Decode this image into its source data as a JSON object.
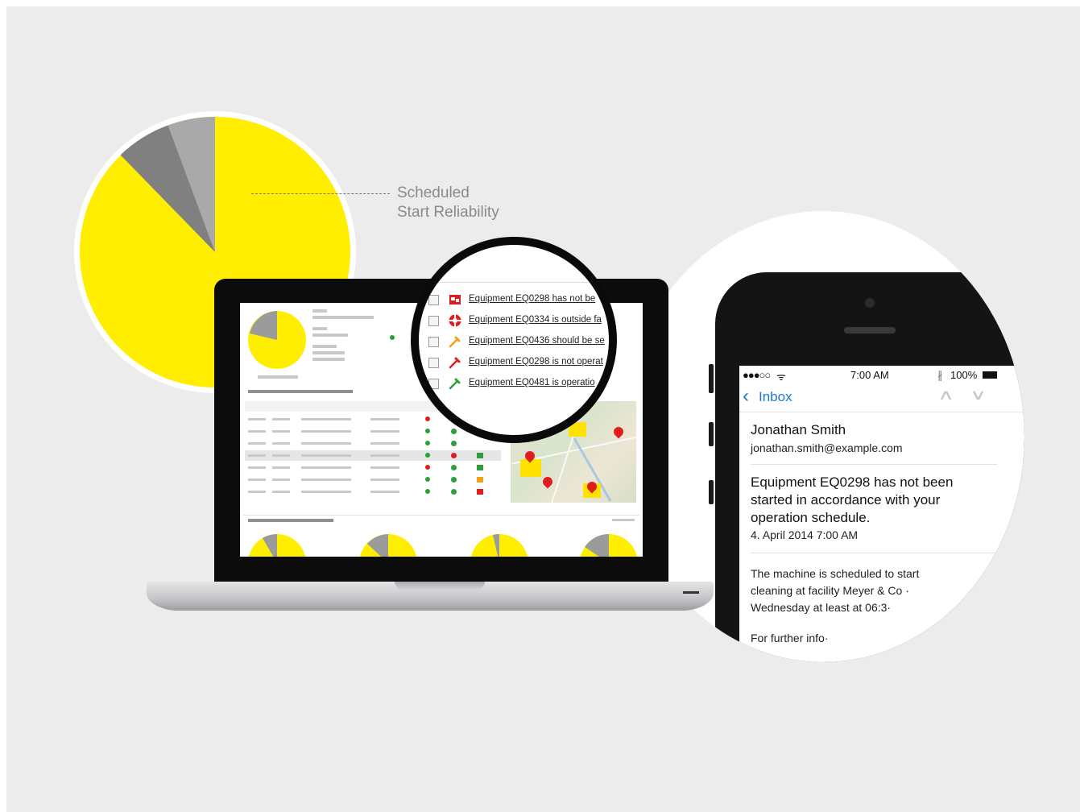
{
  "pie_label": {
    "line1": "Scheduled",
    "line2": "Start Reliability"
  },
  "colors": {
    "accent_yellow": "#ffee00",
    "slice_dark_gray": "#808080",
    "slice_light_gray": "#a9a9a9",
    "link_blue": "#1d78d6",
    "alert_red": "#e01d1d",
    "alert_orange": "#f4a11a",
    "alert_green": "#2e9e3c"
  },
  "alerts": [
    {
      "icon": "stop-icon",
      "color": "#e01d1d",
      "text": "Equipment EQ0298 has not be"
    },
    {
      "icon": "lifebuoy-icon",
      "color": "#e01d1d",
      "text": "Equipment EQ0334 is outside fa"
    },
    {
      "icon": "wrench-icon",
      "color": "#f4a11a",
      "text": "Equipment EQ0436 should be se"
    },
    {
      "icon": "wrench-icon",
      "color": "#e01d1d",
      "text": "Equipment EQ0298 is not operat"
    },
    {
      "icon": "wrench-icon",
      "color": "#2e9e3c",
      "text": "Equipment EQ0481 is operatio"
    }
  ],
  "phone": {
    "status": {
      "signal": "●●●○○",
      "wifi": "ᯤ",
      "time": "7:00 AM",
      "bluetooth": "∦",
      "battery": "100%"
    },
    "nav": {
      "back_label": "Inbox"
    },
    "sender_name": "Jonathan Smith",
    "sender_email": "jonathan.smith@example.com",
    "subject": "Equipment EQ0298 has not been started in accordance with your operation schedule.",
    "date": "4. April 2014 7:00 AM",
    "body": "The machine is scheduled to start cleaning at facility Meyer & Co · Wednesday at least at 06:3·",
    "more": "For further info·"
  }
}
